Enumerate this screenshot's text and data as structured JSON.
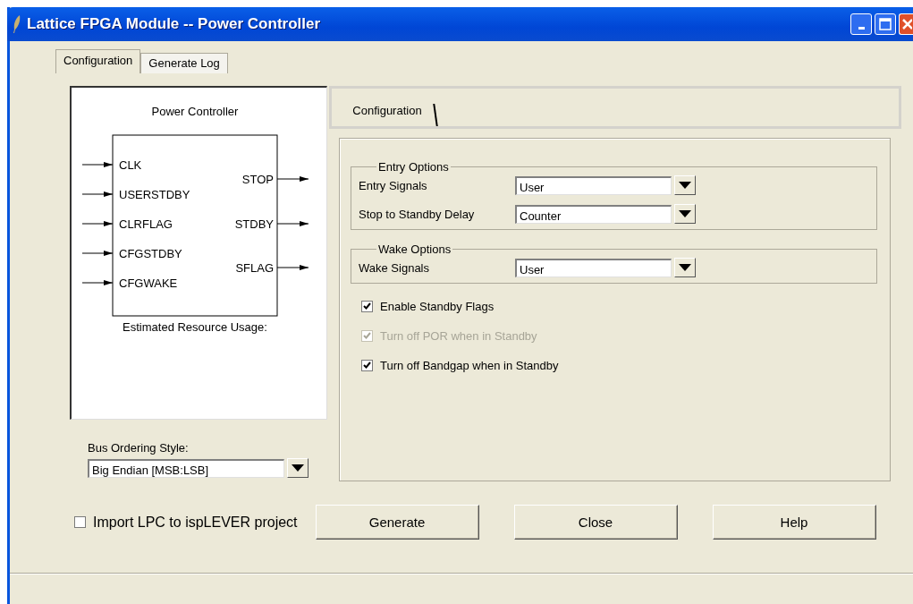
{
  "window": {
    "title": "Lattice FPGA Module -- Power Controller"
  },
  "tabs": [
    {
      "label": "Configuration",
      "selected": true
    },
    {
      "label": "Generate Log",
      "selected": false
    }
  ],
  "diagram": {
    "title": "Power Controller",
    "inputs": [
      "CLK",
      "USERSTDBY",
      "CLRFLAG",
      "CFGSTDBY",
      "CFGWAKE"
    ],
    "outputs": [
      "STOP",
      "STDBY",
      "SFLAG"
    ],
    "footer": "Estimated Resource Usage:"
  },
  "bus_ordering": {
    "label": "Bus Ordering Style:",
    "value": "Big Endian [MSB:LSB]"
  },
  "inner_tabs": [
    {
      "label": "Configuration",
      "selected": true
    }
  ],
  "groups": [
    {
      "title": "Entry Options",
      "fields": [
        {
          "label": "Entry Signals",
          "value": "User"
        },
        {
          "label": "Stop to Standby Delay",
          "value": "Counter"
        }
      ]
    },
    {
      "title": "Wake Options",
      "fields": [
        {
          "label": "Wake Signals",
          "value": "User"
        }
      ]
    }
  ],
  "options": [
    {
      "label": "Enable Standby Flags",
      "checked": true,
      "disabled": false
    },
    {
      "label": "Turn off POR when in Standby",
      "checked": true,
      "disabled": true
    },
    {
      "label": "Turn off Bandgap when in Standby",
      "checked": true,
      "disabled": false
    }
  ],
  "import_option": {
    "label": "Import LPC to ispLEVER project",
    "checked": false
  },
  "buttons": [
    "Generate",
    "Close",
    "Help"
  ]
}
